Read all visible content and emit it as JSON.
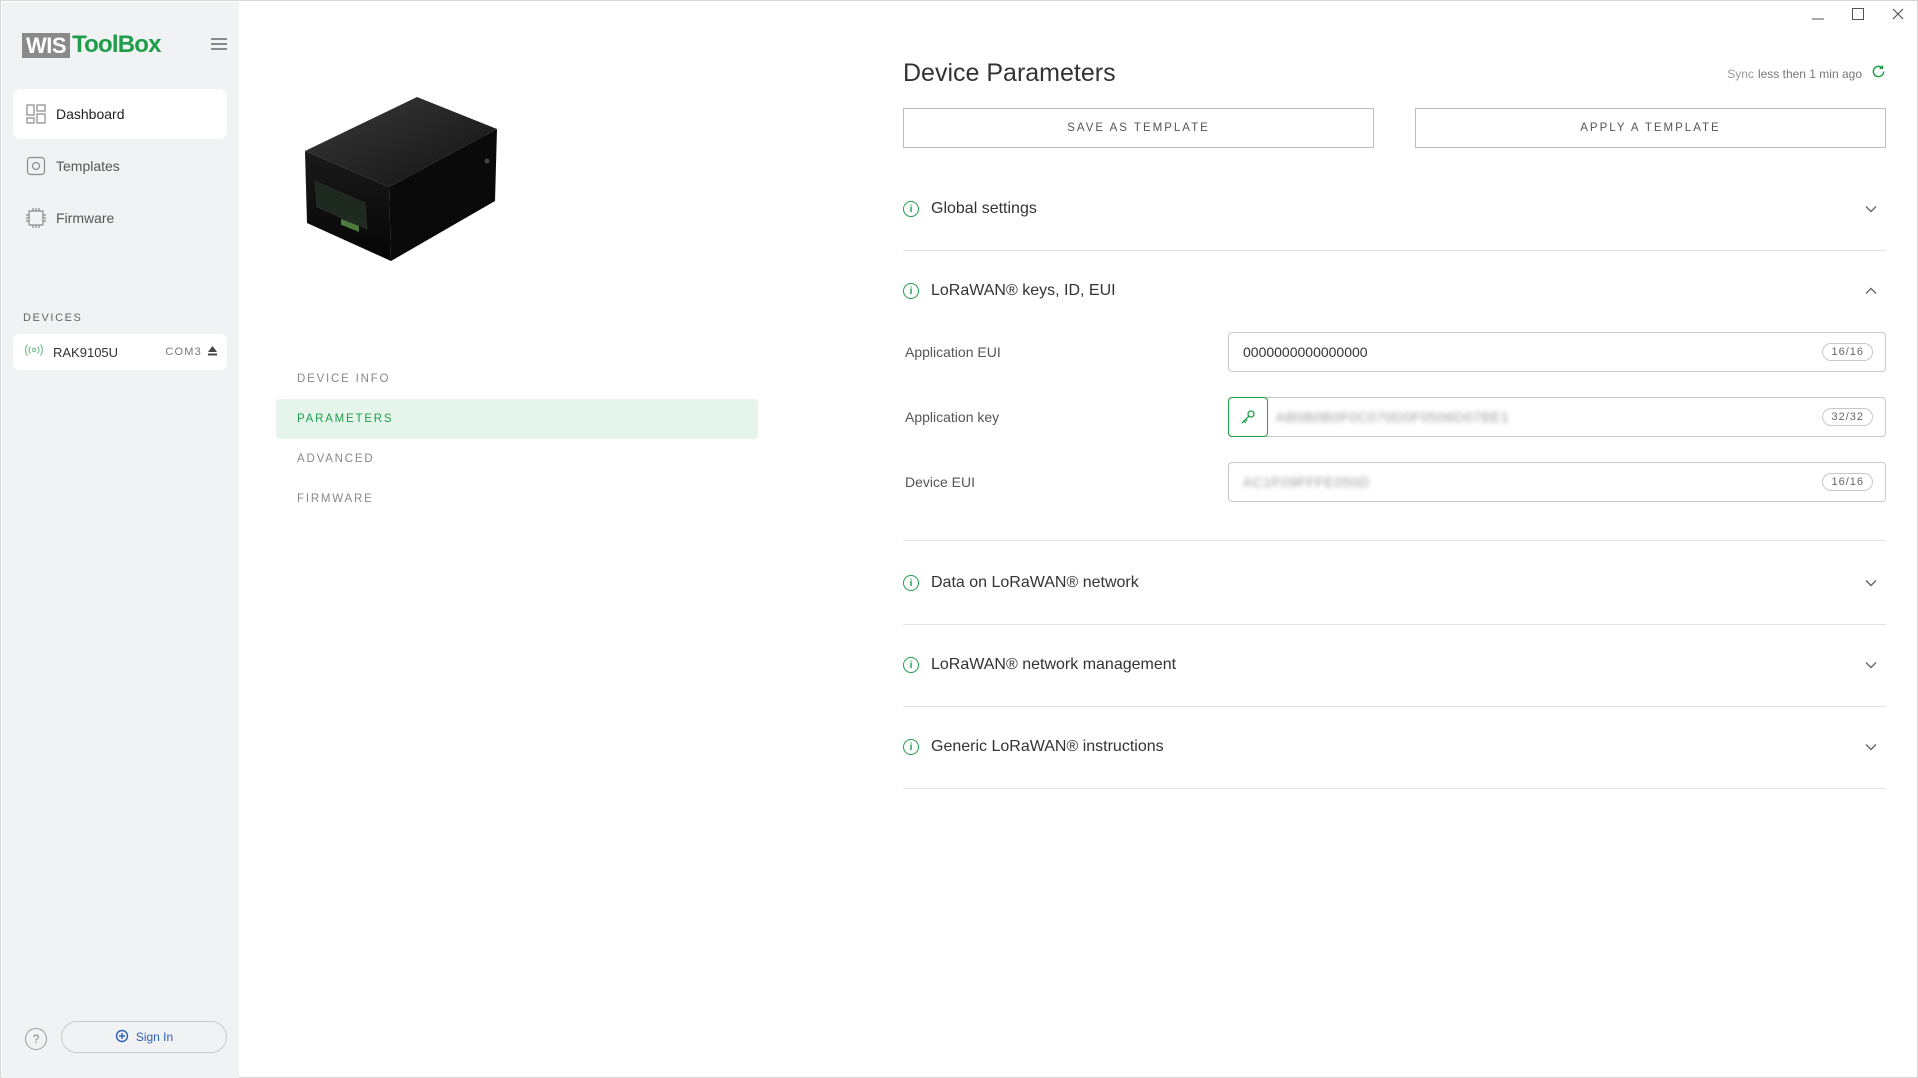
{
  "app": {
    "logo_left": "WIS",
    "logo_right": "ToolBox"
  },
  "sidebar": {
    "items": [
      {
        "label": "Dashboard",
        "icon": "dashboard-icon"
      },
      {
        "label": "Templates",
        "icon": "templates-icon"
      },
      {
        "label": "Firmware",
        "icon": "firmware-chip-icon"
      }
    ],
    "devices_label": "DEVICES",
    "device": {
      "name": "RAK9105U",
      "port": "COM3",
      "icon": "wireless-signal-icon"
    },
    "help_label": "?",
    "signin_label": "Sign In"
  },
  "device_tabs": [
    {
      "label": "DEVICE INFO"
    },
    {
      "label": "PARAMETERS"
    },
    {
      "label": "ADVANCED"
    },
    {
      "label": "FIRMWARE"
    }
  ],
  "main": {
    "title": "Device Parameters",
    "sync_prefix": "Sync",
    "sync_text": "less then 1 min ago",
    "save_template": "SAVE AS TEMPLATE",
    "apply_template": "APPLY A TEMPLATE",
    "sections": [
      {
        "title": "Global settings",
        "expanded": false
      },
      {
        "title": "LoRaWAN® keys, ID, EUI",
        "expanded": true
      },
      {
        "title": "Data on LoRaWAN® network",
        "expanded": false
      },
      {
        "title": "LoRaWAN® network management",
        "expanded": false
      },
      {
        "title": "Generic LoRaWAN® instructions",
        "expanded": false
      }
    ],
    "fields": [
      {
        "label": "Application EUI",
        "value": "0000000000000000",
        "counter": "16/16"
      },
      {
        "label": "Application key",
        "value": "AB0B0B0F0C070D0F0506D07BE1",
        "counter": "32/32"
      },
      {
        "label": "Device EUI",
        "value": "AC1F09FFFE050D",
        "counter": "16/16"
      }
    ]
  },
  "colors": {
    "accent": "#1e9e4a",
    "sidebar_bg": "#f1f2f3",
    "active_tab_bg": "#e6f5eb"
  }
}
